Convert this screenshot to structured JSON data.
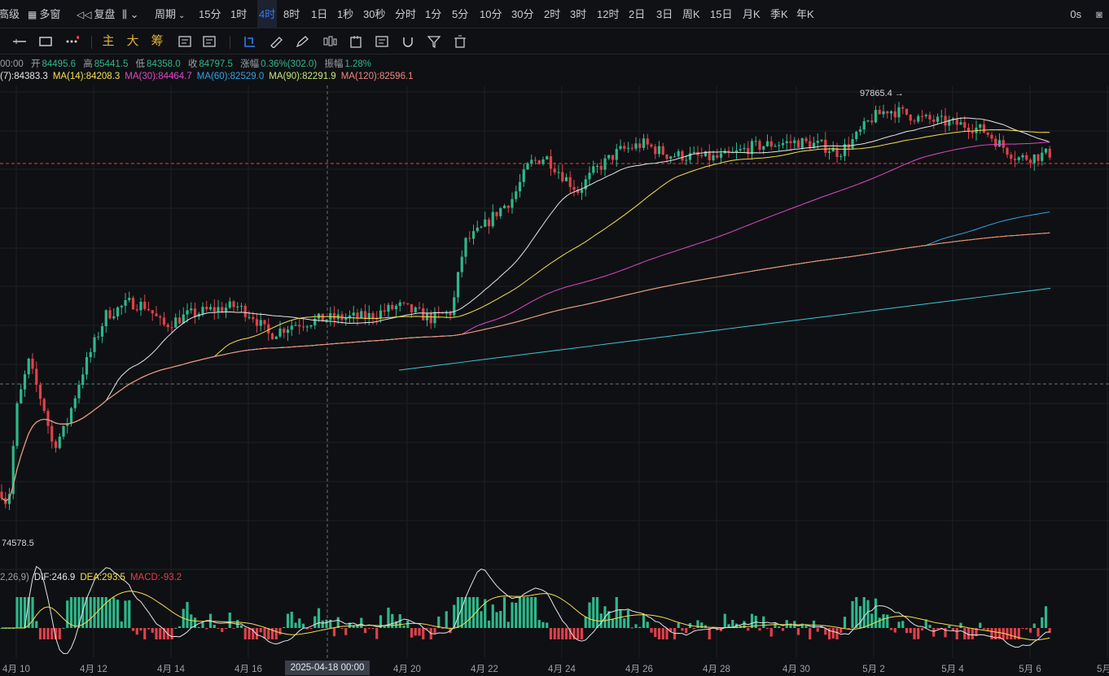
{
  "toolbar": {
    "items": [
      {
        "label": "高级",
        "active": false
      },
      {
        "label": "多窗",
        "icon": "grid-icon",
        "active": false
      },
      {
        "label": "复盘",
        "icon": "rewind-icon",
        "active": false
      },
      {
        "label": "",
        "icon": "chart-type-icon",
        "active": false
      },
      {
        "label": "周期",
        "icon": "chevron-down-icon",
        "active": false
      },
      {
        "label": "15分",
        "active": false
      },
      {
        "label": "1时",
        "active": false
      },
      {
        "label": "4时",
        "active": true
      },
      {
        "label": "8时",
        "active": false
      },
      {
        "label": "1日",
        "active": false
      },
      {
        "label": "1秒",
        "active": false
      },
      {
        "label": "30秒",
        "active": false
      },
      {
        "label": "分时",
        "active": false
      },
      {
        "label": "1分",
        "active": false
      },
      {
        "label": "5分",
        "active": false
      },
      {
        "label": "10分",
        "active": false
      },
      {
        "label": "30分",
        "active": false
      },
      {
        "label": "2时",
        "active": false
      },
      {
        "label": "3时",
        "active": false
      },
      {
        "label": "12时",
        "active": false
      },
      {
        "label": "2日",
        "active": false
      },
      {
        "label": "3日",
        "active": false
      },
      {
        "label": "周K",
        "active": false
      },
      {
        "label": "15日",
        "active": false
      },
      {
        "label": "月K",
        "active": false
      },
      {
        "label": "季K",
        "active": false
      },
      {
        "label": "年K",
        "active": false
      }
    ],
    "right_label": "0s"
  },
  "drawtools": {
    "icons": [
      "horizontal-line-icon",
      "rectangle-icon",
      "more-dots-icon"
    ],
    "text_buttons": [
      "主",
      "大",
      "筹"
    ],
    "tool_icons": [
      "select-tool-icon",
      "ruler-icon",
      "pen-icon",
      "candle-icon",
      "calendar-icon",
      "note-icon",
      "magnet-icon",
      "filter-icon",
      "trash-icon"
    ]
  },
  "ohlc_info": {
    "time": "00:00",
    "open_label": "开",
    "open": "84495.6",
    "high_label": "高",
    "high": "85441.5",
    "low_label": "低",
    "low": "84358.0",
    "close_label": "收",
    "close": "84797.5",
    "change_label": "涨幅",
    "change": "0.36%(302.0)",
    "amp_label": "振幅",
    "amp": "1.28%"
  },
  "ma_info": [
    {
      "label": "(7):84383.3",
      "color": "#e6e6e6"
    },
    {
      "label": "MA(14):84208.3",
      "color": "#f5e050"
    },
    {
      "label": "MA(30):84464.7",
      "color": "#e048c8"
    },
    {
      "label": "MA(60):82529.0",
      "color": "#2fa6e8"
    },
    {
      "label": "MA(90):82291.9",
      "color": "#c8e878"
    },
    {
      "label": "MA(120):82596.1",
      "color": "#f08878"
    }
  ],
  "macd_info": [
    {
      "label": "2,26,9)",
      "color": "#9aa0aa"
    },
    {
      "label": "DIF:246.9",
      "color": "#e6e6e6"
    },
    {
      "label": "DEA:293.5",
      "color": "#f5e050"
    },
    {
      "label": "MACD:-93.2",
      "color": "#e0404a"
    }
  ],
  "chart_data": {
    "type": "candlestick",
    "high_label": "97865.4",
    "low_label": "74578.5",
    "x_ticks": [
      "4月 10",
      "4月 12",
      "4月 14",
      "4月 16",
      "4月 20",
      "4月 22",
      "4月 24",
      "4月 26",
      "4月 28",
      "4月 30",
      "5月 2",
      "5月 4",
      "5月 6",
      "5月"
    ],
    "cursor_time": "2025-04-18 00:00",
    "colors": {
      "up": "#2eb88a",
      "down": "#e0404a"
    }
  }
}
